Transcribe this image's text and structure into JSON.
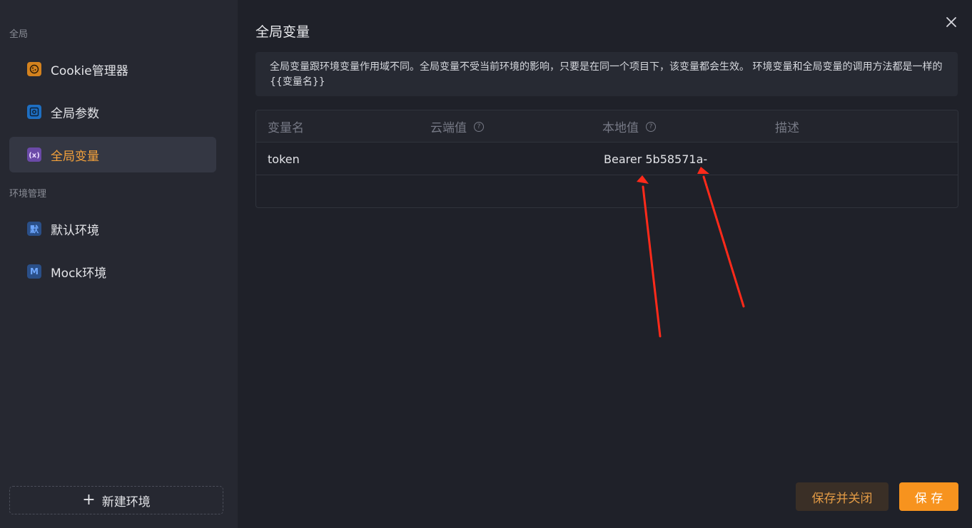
{
  "sidebar": {
    "section_global": "全局",
    "items_global": [
      {
        "label": "Cookie管理器",
        "icon": "cookie-icon"
      },
      {
        "label": "全局参数",
        "icon": "gear-icon"
      },
      {
        "label": "全局变量",
        "icon": "variable-icon"
      }
    ],
    "section_env": "环境管理",
    "items_env": [
      {
        "label": "默认环境",
        "icon_text": "默"
      },
      {
        "label": "Mock环境",
        "icon_text": "M"
      }
    ],
    "new_env_label": "新建环境"
  },
  "main": {
    "title": "全局变量",
    "notice": "全局变量跟环境变量作用域不同。全局变量不受当前环境的影响，只要是在同一个项目下，该变量都会生效。 环境变量和全局变量的调用方法都是一样的 {{变量名}}",
    "table": {
      "headers": [
        "变量名",
        "云端值",
        "本地值",
        "描述"
      ],
      "rows": [
        {
          "name": "token",
          "cloud": "",
          "local": "Bearer 5b58571a-",
          "desc": ""
        }
      ]
    },
    "buttons": {
      "save_close": "保存并关闭",
      "save": "保 存"
    }
  },
  "colors": {
    "accent": "#f7931e",
    "active_text": "#f5a23b",
    "annotation_arrow": "#ff2a1a"
  }
}
